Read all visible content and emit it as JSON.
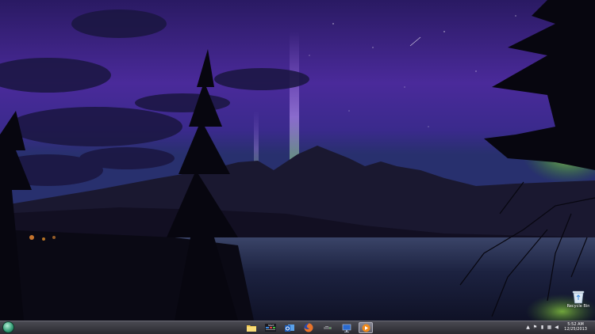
{
  "desktop": {
    "recycle_bin_label": "Recycle Bin"
  },
  "taskbar": {
    "start_button_icon": "windows-orb-icon",
    "pinned": [
      {
        "icon": "file-explorer-icon"
      },
      {
        "icon": "start8-icon",
        "label": "Start"
      },
      {
        "icon": "outlook-icon"
      },
      {
        "icon": "firefox-icon"
      },
      {
        "icon": "remote-device-icon"
      },
      {
        "icon": "monitor-icon"
      },
      {
        "icon": "media-player-icon"
      }
    ],
    "tray": {
      "icons": [
        "show-hidden-icon",
        "flag-icon",
        "battery-icon",
        "network-icon",
        "volume-icon"
      ],
      "time": "5:52 AM",
      "date": "12/25/2013"
    }
  }
}
